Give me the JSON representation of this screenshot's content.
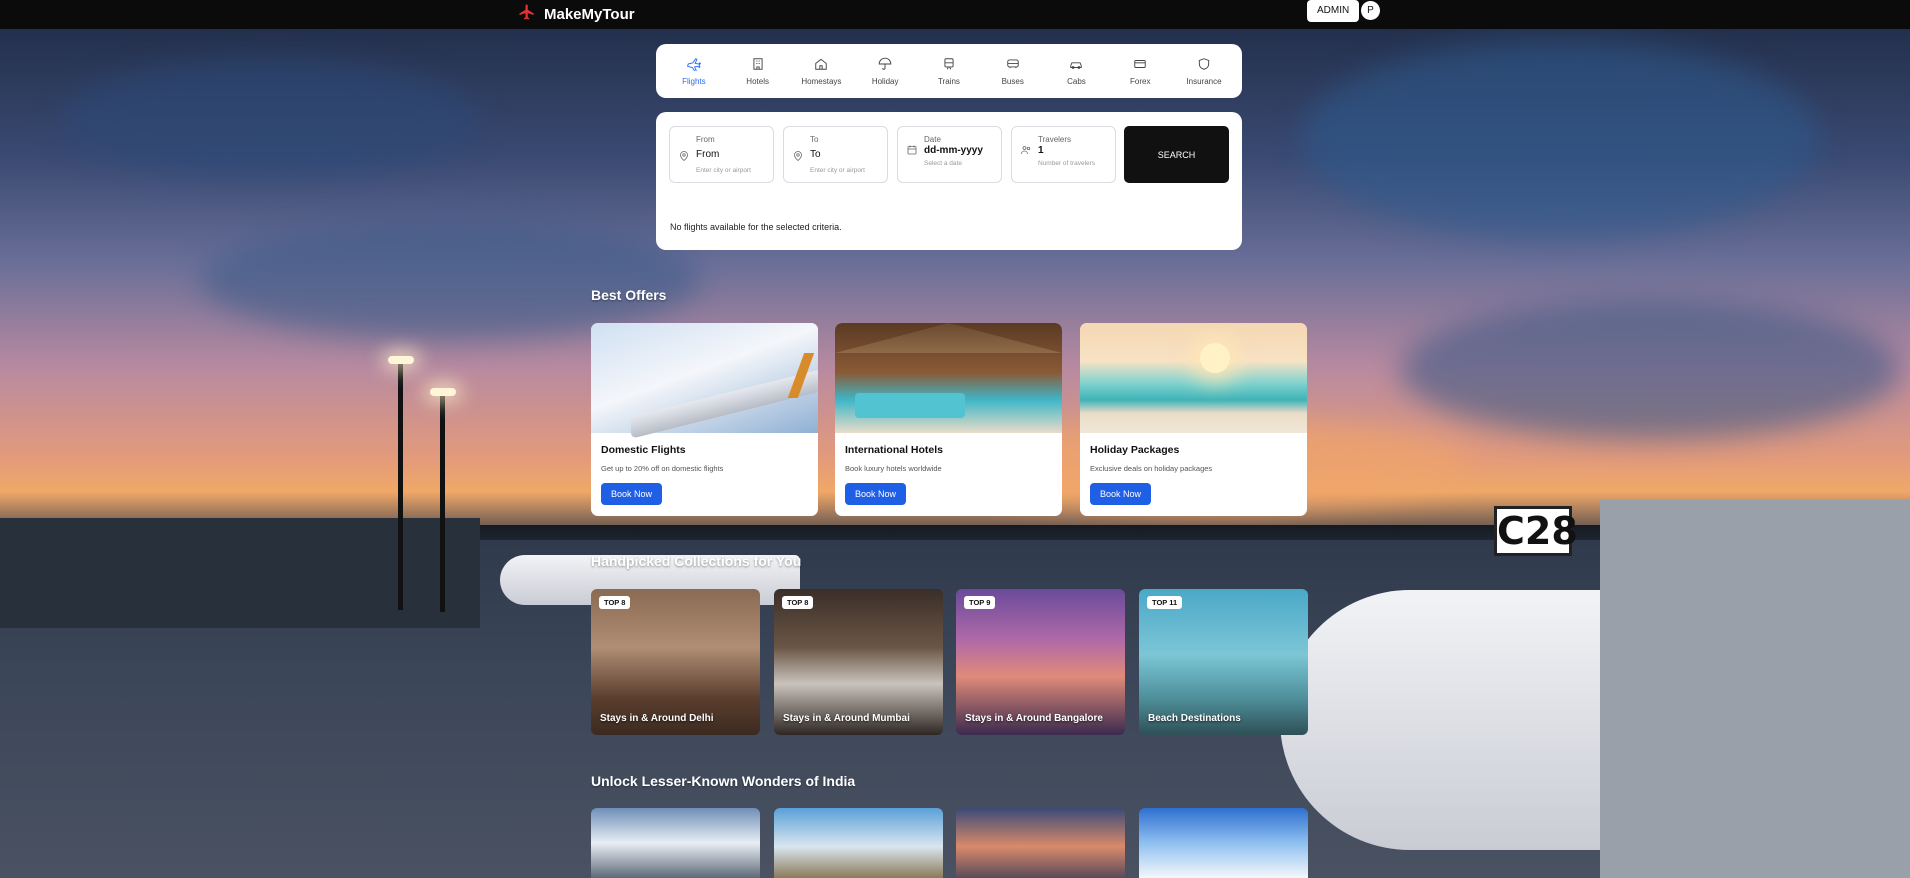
{
  "app": {
    "brand": "MakeMyTour",
    "admin_label": "ADMIN",
    "avatar_initial": "P"
  },
  "tabs": [
    {
      "label": "Flights",
      "icon": "plane-icon",
      "active": true
    },
    {
      "label": "Hotels",
      "icon": "building-icon"
    },
    {
      "label": "Homestays",
      "icon": "home-icon"
    },
    {
      "label": "Holiday",
      "icon": "umbrella-icon"
    },
    {
      "label": "Trains",
      "icon": "train-icon"
    },
    {
      "label": "Buses",
      "icon": "bus-icon"
    },
    {
      "label": "Cabs",
      "icon": "car-icon"
    },
    {
      "label": "Forex",
      "icon": "card-icon"
    },
    {
      "label": "Insurance",
      "icon": "shield-icon"
    }
  ],
  "search": {
    "from": {
      "label": "From",
      "value": "From",
      "hint": "Enter city or airport"
    },
    "to": {
      "label": "To",
      "value": "To",
      "hint": "Enter city or airport"
    },
    "date": {
      "label": "Date",
      "value": "dd-mm-yyyy",
      "hint": "Select a date"
    },
    "travelers": {
      "label": "Travelers",
      "value": "1",
      "hint": "Number of travelers"
    },
    "button": "SEARCH",
    "result_message": "No flights available for the selected criteria."
  },
  "offers": {
    "title": "Best Offers",
    "items": [
      {
        "title": "Domestic Flights",
        "desc": "Get up to 20% off on domestic flights",
        "button": "Book Now"
      },
      {
        "title": "International Hotels",
        "desc": "Book luxury hotels worldwide",
        "button": "Book Now"
      },
      {
        "title": "Holiday Packages",
        "desc": "Exclusive deals on holiday packages",
        "button": "Book Now"
      }
    ]
  },
  "collections": {
    "title": "Handpicked Collections for You",
    "items": [
      {
        "badge": "TOP 8",
        "title": "Stays in & Around Delhi"
      },
      {
        "badge": "TOP 8",
        "title": "Stays in & Around Mumbai"
      },
      {
        "badge": "TOP 9",
        "title": "Stays in & Around Bangalore"
      },
      {
        "badge": "TOP 11",
        "title": "Beach Destinations"
      }
    ]
  },
  "wonders": {
    "title": "Unlock Lesser-Known Wonders of India"
  },
  "background_sign": "C28",
  "colors": {
    "accent": "#2a6df4",
    "button_blue": "#1f5fe6",
    "topbar": "#0b0b0b",
    "search_button": "#111111"
  }
}
